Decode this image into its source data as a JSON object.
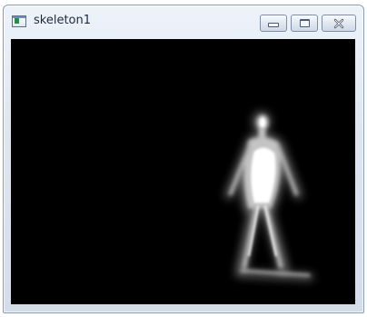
{
  "window": {
    "title": "skeleton1",
    "controls": {
      "minimize": "minimize",
      "maximize": "maximize",
      "close": "close"
    }
  },
  "canvas": {
    "background": "#000000",
    "content": "grayscale-silhouette"
  },
  "colors": {
    "chrome": "#dde6f1",
    "figure_core": "#ffffff",
    "figure_glow": "#9a9a9a"
  }
}
